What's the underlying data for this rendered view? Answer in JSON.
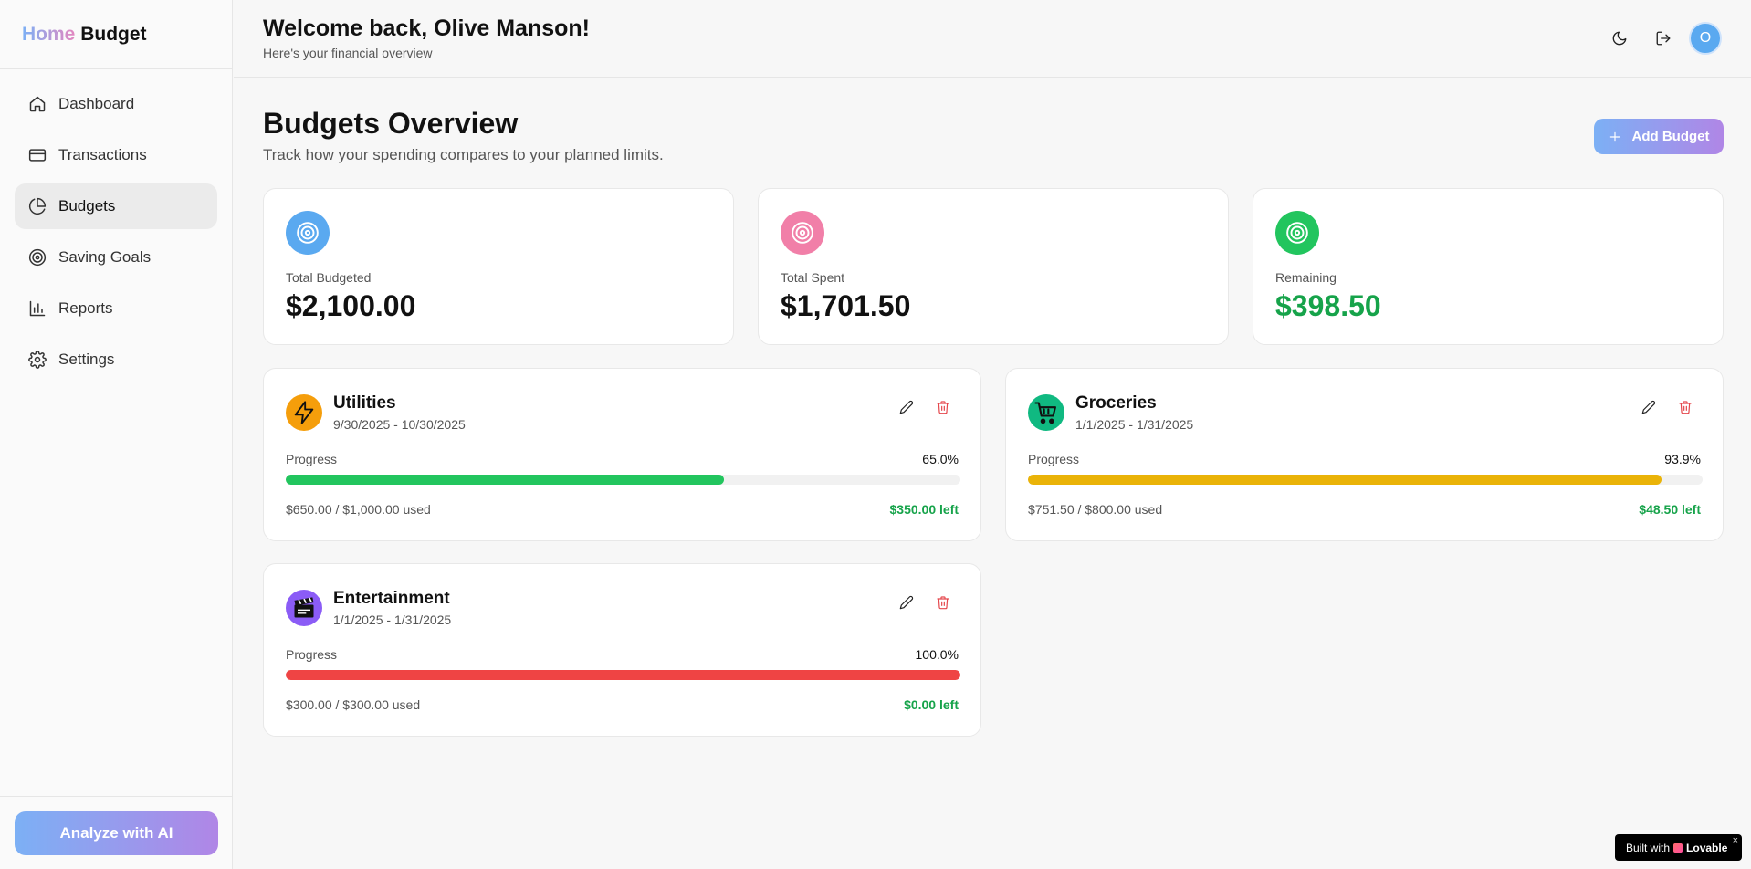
{
  "brand": {
    "part1": "Home",
    "part2": "Budget"
  },
  "sidebar": {
    "items": [
      {
        "label": "Dashboard",
        "icon": "home-icon"
      },
      {
        "label": "Transactions",
        "icon": "credit-card-icon"
      },
      {
        "label": "Budgets",
        "icon": "pie-chart-icon",
        "active": true
      },
      {
        "label": "Saving Goals",
        "icon": "target-icon"
      },
      {
        "label": "Reports",
        "icon": "bar-chart-icon"
      },
      {
        "label": "Settings",
        "icon": "gear-icon"
      }
    ],
    "analyze_label": "Analyze with AI"
  },
  "header": {
    "welcome": "Welcome back, Olive Manson!",
    "subtitle": "Here's your financial overview",
    "avatar_initial": "O"
  },
  "main": {
    "title": "Budgets Overview",
    "subtitle": "Track how your spending compares to your planned limits.",
    "add_button": "Add Budget"
  },
  "stats": [
    {
      "label": "Total Budgeted",
      "value": "$2,100.00",
      "color": "#5aa9f0"
    },
    {
      "label": "Total Spent",
      "value": "$1,701.50",
      "color": "#f17fa8"
    },
    {
      "label": "Remaining",
      "value": "$398.50",
      "color": "#22c55e"
    }
  ],
  "budgets": [
    {
      "name": "Utilities",
      "dates": "9/30/2025 - 10/30/2025",
      "progress_label": "Progress",
      "percent": "65.0%",
      "fill_fraction": 0.65,
      "bar_color": "#22c55e",
      "used": "$650.00 / $1,000.00 used",
      "left": "$350.00 left",
      "icon": "lightning-icon",
      "icon_bg": "#f59e0b"
    },
    {
      "name": "Groceries",
      "dates": "1/1/2025 - 1/31/2025",
      "progress_label": "Progress",
      "percent": "93.9%",
      "fill_fraction": 0.939,
      "bar_color": "#eab308",
      "used": "$751.50 / $800.00 used",
      "left": "$48.50 left",
      "icon": "shopping-cart-icon",
      "icon_bg": "#10b981"
    },
    {
      "name": "Entertainment",
      "dates": "1/1/2025 - 1/31/2025",
      "progress_label": "Progress",
      "percent": "100.0%",
      "fill_fraction": 1.0,
      "bar_color": "#ef4444",
      "used": "$300.00 / $300.00 used",
      "left": "$0.00 left",
      "icon": "clapperboard-icon",
      "icon_bg": "#8b5cf6"
    }
  ],
  "badge": {
    "prefix": "Built with",
    "brand": "Lovable",
    "close": "×"
  }
}
